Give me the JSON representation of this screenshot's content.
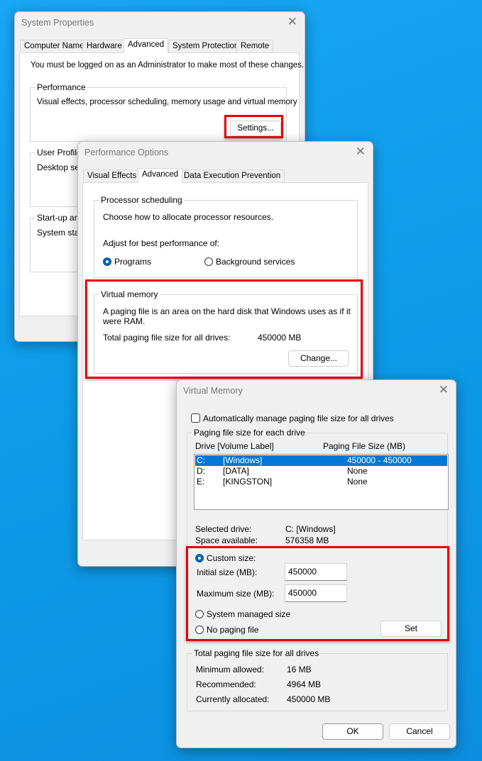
{
  "sys": {
    "title": "System Properties",
    "tabs": [
      "Computer Name",
      "Hardware",
      "Advanced",
      "System Protection",
      "Remote"
    ],
    "admin_note": "You must be logged on as an Administrator to make most of these changes.",
    "perf_legend": "Performance",
    "perf_desc": "Visual effects, processor scheduling, memory usage and virtual memory",
    "settings": "Settings...",
    "profiles_legend": "User Profiles",
    "profiles_desc": "Desktop setti",
    "startup_legend": "Start-up and",
    "startup_desc": "System start"
  },
  "perf": {
    "title": "Performance Options",
    "tabs": [
      "Visual Effects",
      "Advanced",
      "Data Execution Prevention"
    ],
    "proc_legend": "Processor scheduling",
    "proc_desc": "Choose how to allocate processor resources.",
    "adjust": "Adjust for best performance of:",
    "programs": "Programs",
    "background": "Background services",
    "vm_legend": "Virtual memory",
    "vm_desc": "A paging file is an area on the hard disk that Windows uses as if it were RAM.",
    "total_label": "Total paging file size for all drives:",
    "total_value": "450000 MB",
    "change": "Change..."
  },
  "vm": {
    "title": "Virtual Memory",
    "auto": "Automatically manage paging file size for all drives",
    "each_legend": "Paging file size for each drive",
    "col_drive": "Drive  [Volume Label]",
    "col_size": "Paging File Size (MB)",
    "drives": [
      {
        "d": "C:",
        "l": "[Windows]",
        "s": "450000 - 450000",
        "selected": true
      },
      {
        "d": "D:",
        "l": "[DATA]",
        "s": "None"
      },
      {
        "d": "E:",
        "l": "[KINGSTON]",
        "s": "None"
      }
    ],
    "sel_label": "Selected drive:",
    "sel_value": "C:  [Windows]",
    "space_label": "Space available:",
    "space_value": "576358 MB",
    "custom": "Custom size:",
    "initial_label": "Initial size (MB):",
    "initial_value": "450000",
    "max_label": "Maximum size (MB):",
    "max_value": "450000",
    "system_managed": "System managed size",
    "no_paging": "No paging file",
    "set": "Set",
    "total_legend": "Total paging file size for all drives",
    "min_label": "Minimum allowed:",
    "min_value": "16 MB",
    "rec_label": "Recommended:",
    "rec_value": "4964 MB",
    "cur_label": "Currently allocated:",
    "cur_value": "450000 MB",
    "ok": "OK",
    "cancel": "Cancel"
  },
  "colors": {
    "highlight": "#e50000",
    "selection": "#0078d7"
  }
}
